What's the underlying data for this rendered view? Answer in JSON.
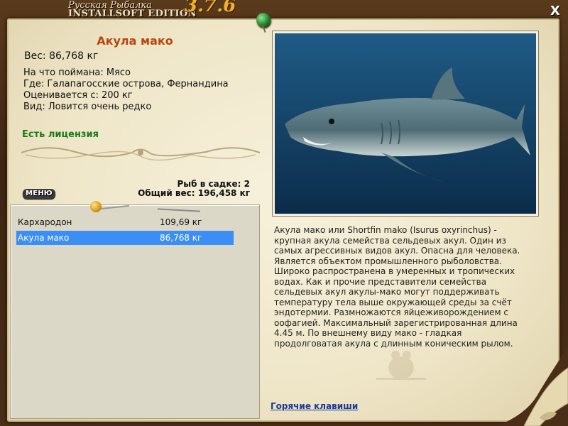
{
  "app": {
    "title_line1": "Русская Рыбалка",
    "title_line2": "INSTALLSOFT EDITION",
    "version": "3.7.6",
    "close_label": "X"
  },
  "fish": {
    "name": "Акула мако",
    "weight_line": "Вес: 86,768 кг",
    "caught_on": "На что поймана: Мясо",
    "location": "Где: Галапагосские острова, Фернандина",
    "valued_from": "Оценивается с: 200 кг",
    "rarity": "Вид: Ловится очень редко",
    "license": "Есть лицензия",
    "description": "Акула мако или Shortfin mako (Isurus oxyrinchus) - крупная акула семейства сельдевых акул. Один из самых агрессивных видов акул. Опасна для человека. Является объектом промышленного рыболовства. Широко распространена в умеренных и тропических водах. Как и прочие представители семейства сельдевых акул акулы-мако могут поддерживать температуру тела выше окружающей среды за счёт эндотермии. Размножаются яйцеживорождением с оофагией. Максимальный зарегистрированная длина 4.45 м. По внешнему виду мако - гладкая продолговатая акула с длинным коническим рылом."
  },
  "keepnet": {
    "count_line": "Рыб в садке: 2",
    "total_line": "Общий вес: 196,458 кг",
    "items": [
      {
        "name": "Кархародон",
        "weight": "109,69 кг"
      },
      {
        "name": "Акула мако",
        "weight": "86,768 кг"
      }
    ]
  },
  "menu_label": "МЕНЮ",
  "hotkeys_label": "Горячие клавиши",
  "colors": {
    "fish_name": "#b8460d",
    "license": "#1b7a1b",
    "selection": "#3b8ef5",
    "link": "#1a3a9a"
  }
}
